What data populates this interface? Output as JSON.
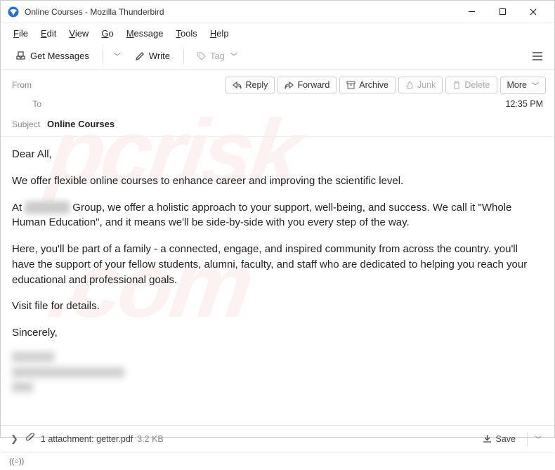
{
  "window": {
    "title": "Online Courses - Mozilla Thunderbird"
  },
  "menu": {
    "file": "File",
    "edit": "Edit",
    "view": "View",
    "go": "Go",
    "message": "Message",
    "tools": "Tools",
    "help": "Help"
  },
  "toolbar": {
    "get_messages": "Get Messages",
    "write": "Write",
    "tag": "Tag"
  },
  "headers": {
    "from_label": "From",
    "to_label": "To",
    "subject_label": "Subject",
    "subject_value": "Online Courses",
    "time": "12:35 PM"
  },
  "actions": {
    "reply": "Reply",
    "forward": "Forward",
    "archive": "Archive",
    "junk": "Junk",
    "delete": "Delete",
    "more": "More"
  },
  "body": {
    "p1": "Dear All,",
    "p2": "We offer flexible online courses to enhance career and improving the scientific level.",
    "p3a": "At ",
    "p3_redact": "██████",
    "p3b": " Group, we offer a holistic approach to your support, well-being, and success. We call it \"Whole Human Education\", and it means we'll be side-by-side with you every step of the way.",
    "p4": "Here, you'll be part of a family - a connected, engage, and inspired community from across the country. you'll have the support of your fellow students, alumni, faculty, and staff who are dedicated to helping you reach your educational and professional goals.",
    "p5": "Visit file for details.",
    "p6": "Sincerely,"
  },
  "attachment": {
    "summary": "1 attachment: getter.pdf",
    "size": "3.2 KB",
    "save": "Save"
  },
  "status": {
    "indicator": "((○))"
  }
}
